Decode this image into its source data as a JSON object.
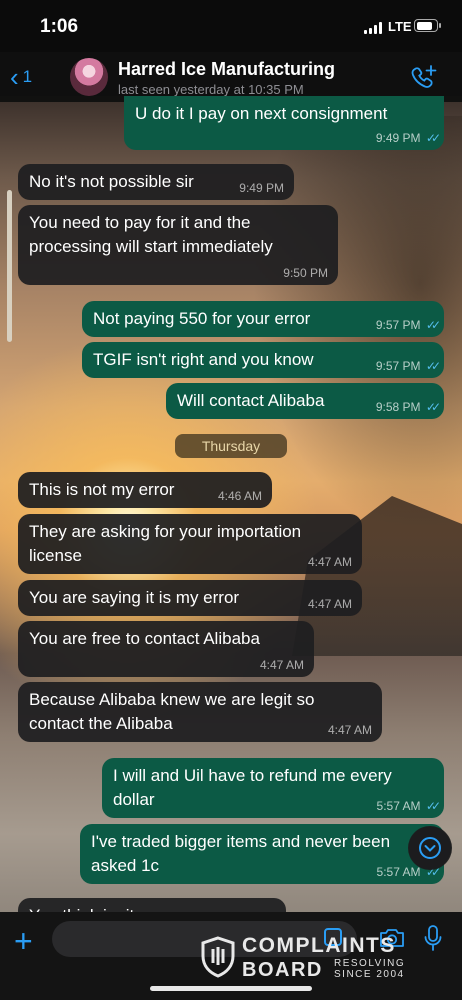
{
  "status_bar": {
    "time": "1:06",
    "network": "LTE",
    "battery_level": 0.85
  },
  "header": {
    "back_count": "1",
    "contact_name": "Harred Ice Manufacturing",
    "last_seen": "last seen yesterday at 10:35 PM"
  },
  "day_separator": "Thursday",
  "messages": [
    {
      "dir": "out",
      "text": "U do it I pay on next consignment",
      "time": "9:49 PM",
      "read": true
    },
    {
      "dir": "in",
      "text": "No it's not possible sir",
      "time": "9:49 PM"
    },
    {
      "dir": "in",
      "text": "You need to pay for it and the processing will start immediately",
      "time": "9:50 PM"
    },
    {
      "dir": "out",
      "text": "Not paying 550 for your error",
      "time": "9:57 PM",
      "read": true
    },
    {
      "dir": "out",
      "text": "TGIF isn't right and you know",
      "time": "9:57 PM",
      "read": true
    },
    {
      "dir": "out",
      "text": "Will contact Alibaba",
      "time": "9:58 PM",
      "read": true
    },
    {
      "dir": "in",
      "text": "This is not my error",
      "time": "4:46 AM"
    },
    {
      "dir": "in",
      "text": "They are asking for your importation license",
      "time": "4:47 AM"
    },
    {
      "dir": "in",
      "text": "You are saying it is my error",
      "time": "4:47 AM"
    },
    {
      "dir": "in",
      "text": "You are free to contact Alibaba",
      "time": "4:47 AM"
    },
    {
      "dir": "in",
      "text": "Because Alibaba knew we are legit so contact the Alibaba",
      "time": "4:47 AM"
    },
    {
      "dir": "out",
      "text": "I will and Uil have to refund me every dollar",
      "time": "5:57 AM",
      "read": true
    },
    {
      "dir": "out",
      "text": "I've traded bigger items and never been asked 1c",
      "time": "5:57 AM",
      "read": true
    },
    {
      "dir": "in",
      "text": "You think i... it",
      "time": ""
    }
  ],
  "read_receipt_glyph": "✓✓",
  "input": {
    "placeholder": ""
  },
  "icons": {
    "back": "chevron-left-icon",
    "call": "add-call-icon",
    "plus": "plus-icon",
    "sticker": "sticker-icon",
    "camera": "camera-icon",
    "mic": "mic-icon",
    "scroll_down": "chevron-down-icon"
  },
  "colors": {
    "accent": "#2a9df4",
    "outgoing_bubble": "#0c5a45",
    "incoming_bubble": "#1e1e20",
    "read_tick": "#53bdeb"
  },
  "watermark": {
    "line1": "COMPLAINTS",
    "line2": "BOARD",
    "sub1": "RESOLVING",
    "sub2": "SINCE 2004"
  }
}
